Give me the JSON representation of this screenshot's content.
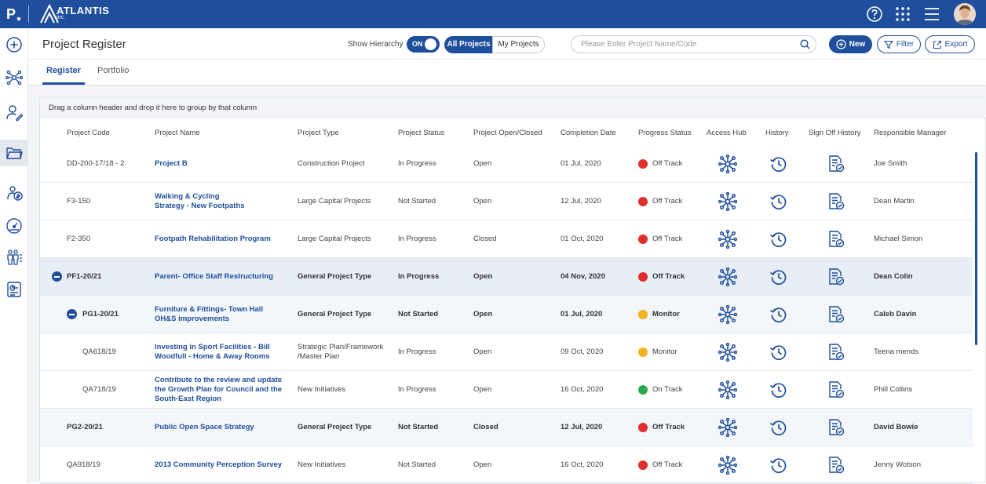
{
  "brand": {
    "letter": "P",
    "name": "ATLANTIS",
    "sub": "inc."
  },
  "header": {
    "title": "Project Register",
    "show_hierarchy_label": "Show Hierarchy",
    "toggle_label": "ON",
    "all_projects_label": "All Projects",
    "my_projects_label": "My Projects",
    "search_placeholder": "Please Enter Project Name/Code",
    "new_label": "New",
    "filter_label": "Filter",
    "export_label": "Export"
  },
  "tabs": [
    {
      "label": "Register",
      "active": true
    },
    {
      "label": "Portfolio",
      "active": false
    }
  ],
  "grid": {
    "grouping_hint": "Drag a column header and drop it here to group by that column",
    "columns": [
      "Project Code",
      "Project Name",
      "Project Type",
      "Project Status",
      "Project Open/Closed",
      "Completion Date",
      "Progress Status",
      "Access Hub",
      "History",
      "Sign Off History",
      "Responsible Manager"
    ],
    "status_colors": {
      "Off Track": "#e02d2d",
      "Monitor": "#f5b21f",
      "On Track": "#2aa84a"
    },
    "rows": [
      {
        "code": "DD-200-17/18 - 2",
        "name": [
          "Project B"
        ],
        "type": [
          "Construction Project"
        ],
        "status": "In Progress",
        "open": "Open",
        "date": "01 Jul, 2020",
        "progress": "Off Track",
        "manager": "Joe Smith",
        "level": 0,
        "style": "normal"
      },
      {
        "code": "F3-150",
        "name": [
          "Walking & Cycling",
          "Strategy - New Footpaths"
        ],
        "type": [
          "Large Capital Projects"
        ],
        "status": "Not Started",
        "open": "Open",
        "date": "12 Jul, 2020",
        "progress": "Off Track",
        "manager": "Dean Martin",
        "level": 0,
        "style": "normal"
      },
      {
        "code": "F2-350",
        "name": [
          "Footpath Rehabilitation Program"
        ],
        "type": [
          "Large Capital Projects"
        ],
        "status": "In Progress",
        "open": "Closed",
        "date": "01 Oct, 2020",
        "progress": "Off Track",
        "manager": "Michael Simon",
        "level": 0,
        "style": "normal"
      },
      {
        "code": "PF1-20/21",
        "name": [
          "Parent- Office Staff Restructuring"
        ],
        "type": [
          "General Project Type"
        ],
        "status": "In Progress",
        "open": "Open",
        "date": "04 Nov, 2020",
        "progress": "Off Track",
        "manager": "Dean Colin",
        "level": 0,
        "style": "parent"
      },
      {
        "code": "PG1-20/21",
        "name": [
          "Furniture & Fittings- Town Hall",
          "OH&S improvements"
        ],
        "type": [
          "General Project Type"
        ],
        "status": "Not Started",
        "open": "Open",
        "date": "01 Jul, 2020",
        "progress": "Monitor",
        "manager": "Caleb Davin",
        "level": 1,
        "style": "child"
      },
      {
        "code": "QA618/19",
        "name": [
          "Investing in Sport Facilities - Bill",
          "Woodfull - Home & Away Rooms"
        ],
        "type": [
          "Strategic Plan/Framework",
          "/Master Plan"
        ],
        "status": "In Progress",
        "open": "Open",
        "date": "09 Oct, 2020",
        "progress": "Monitor",
        "manager": "Teena mends",
        "level": 2,
        "style": "normal"
      },
      {
        "code": "QA718/19",
        "name": [
          "Contribute to the review and update",
          "the Growth Plan for Council and the",
          "South-East Region"
        ],
        "type": [
          "New Initiatives"
        ],
        "status": "In Progress",
        "open": "Open",
        "date": "16 Oct, 2020",
        "progress": "On Track",
        "manager": "Phill Collins",
        "level": 2,
        "style": "normal"
      },
      {
        "code": "PG2-20/21",
        "name": [
          "Public Open Space Strategy"
        ],
        "type": [
          "General Project Type"
        ],
        "status": "Not Started",
        "open": "Closed",
        "date": "12 Jul, 2020",
        "progress": "Off Track",
        "manager": "David Bowie",
        "level": 0,
        "style": "child"
      },
      {
        "code": "QA918/19",
        "name": [
          "2013 Community Perception Survey"
        ],
        "type": [
          "New Initiatives"
        ],
        "status": "Not Started",
        "open": "Open",
        "date": "16 Oct, 2020",
        "progress": "Off Track",
        "manager": "Jenny Wotson",
        "level": 0,
        "style": "normal"
      }
    ]
  }
}
